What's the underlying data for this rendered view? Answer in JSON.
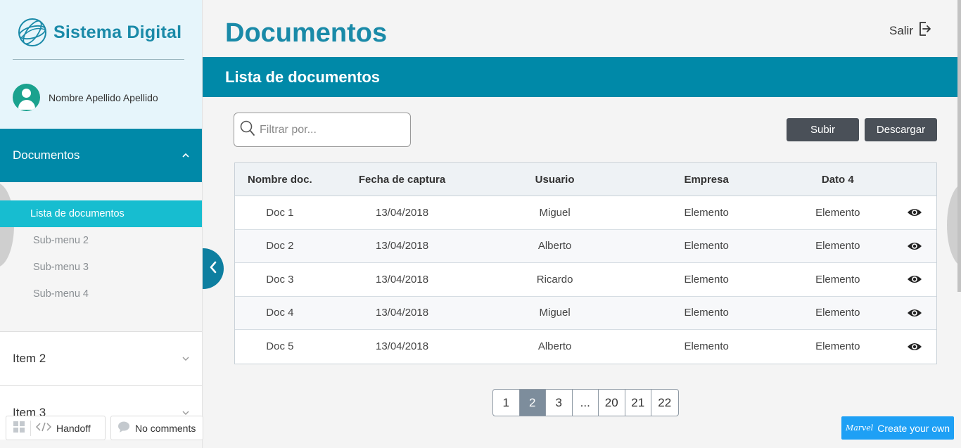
{
  "app": {
    "name": "Sistema Digital"
  },
  "user": {
    "name": "Nombre Apellido Apellido"
  },
  "sidebar": {
    "active_menu": "Documentos",
    "submenu": [
      "Lista de documentos",
      "Sub-menu 2",
      "Sub-menu 3",
      "Sub-menu 4"
    ],
    "items": [
      "Item 2",
      "Item 3"
    ]
  },
  "header": {
    "title": "Documentos",
    "logout_label": "Salir"
  },
  "band": {
    "title": "Lista de documentos"
  },
  "filter": {
    "placeholder": "Filtrar por..."
  },
  "actions": {
    "upload": "Subir",
    "download": "Descargar"
  },
  "table": {
    "columns": [
      "Nombre doc.",
      "Fecha de captura",
      "Usuario",
      "Empresa",
      "Dato 4"
    ],
    "rows": [
      [
        "Doc 1",
        "13/04/2018",
        "Miguel",
        "Elemento",
        "Elemento"
      ],
      [
        "Doc 2",
        "13/04/2018",
        "Alberto",
        "Elemento",
        "Elemento"
      ],
      [
        "Doc 3",
        "13/04/2018",
        "Ricardo",
        "Elemento",
        "Elemento"
      ],
      [
        "Doc 4",
        "13/04/2018",
        "Miguel",
        "Elemento",
        "Elemento"
      ],
      [
        "Doc 5",
        "13/04/2018",
        "Alberto",
        "Elemento",
        "Elemento"
      ]
    ],
    "row_action_icon": "eye-icon"
  },
  "pagination": {
    "pages": [
      "1",
      "2",
      "3",
      "...",
      "20",
      "21",
      "22"
    ],
    "current": "2"
  },
  "bottom_bar": {
    "handoff": "Handoff",
    "comments": "No comments",
    "marvel_logo": "Marvel",
    "create": "Create your own"
  },
  "colors": {
    "primary": "#0089a8",
    "accent": "#17bdd0",
    "title": "#1a8aa8",
    "button_dark": "#4a5058",
    "marvel": "#1ea0f5"
  }
}
